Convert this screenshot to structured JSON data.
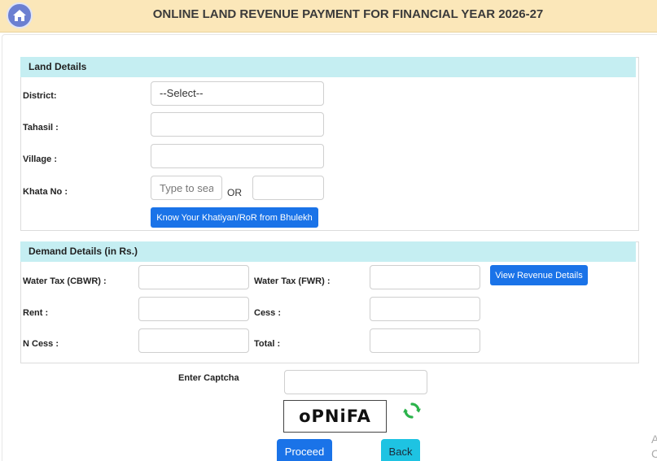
{
  "header": {
    "title": "ONLINE LAND REVENUE PAYMENT FOR FINANCIAL YEAR 2026-27",
    "home_icon": "home-icon",
    "accent_color": "#fbe7b9"
  },
  "land_details": {
    "heading": "Land Details",
    "district_label": "District:",
    "district_value": "--Select--",
    "tahasil_label": "Tahasil :",
    "village_label": "Village :",
    "khata_label": "Khata No :",
    "khata_placeholder": "Type to search",
    "or_text": "OR",
    "bhulekh_button": "Know Your Khatiyan/RoR from Bhulekh"
  },
  "demand_details": {
    "heading": "Demand Details (in Rs.)",
    "water_tax_cbwr_label": "Water Tax (CBWR) :",
    "water_tax_fwr_label": "Water Tax (FWR) :",
    "view_revenue_button": "View Revenue Details",
    "rent_label": "Rent :",
    "cess_label": "Cess :",
    "ncess_label": "N Cess :",
    "total_label": "Total :"
  },
  "captcha": {
    "label": "Enter Captcha",
    "image_text": "oPNiFA",
    "refresh_icon": "refresh-icon"
  },
  "actions": {
    "proceed": "Proceed",
    "back": "Back"
  },
  "edge_text": "A\nC"
}
